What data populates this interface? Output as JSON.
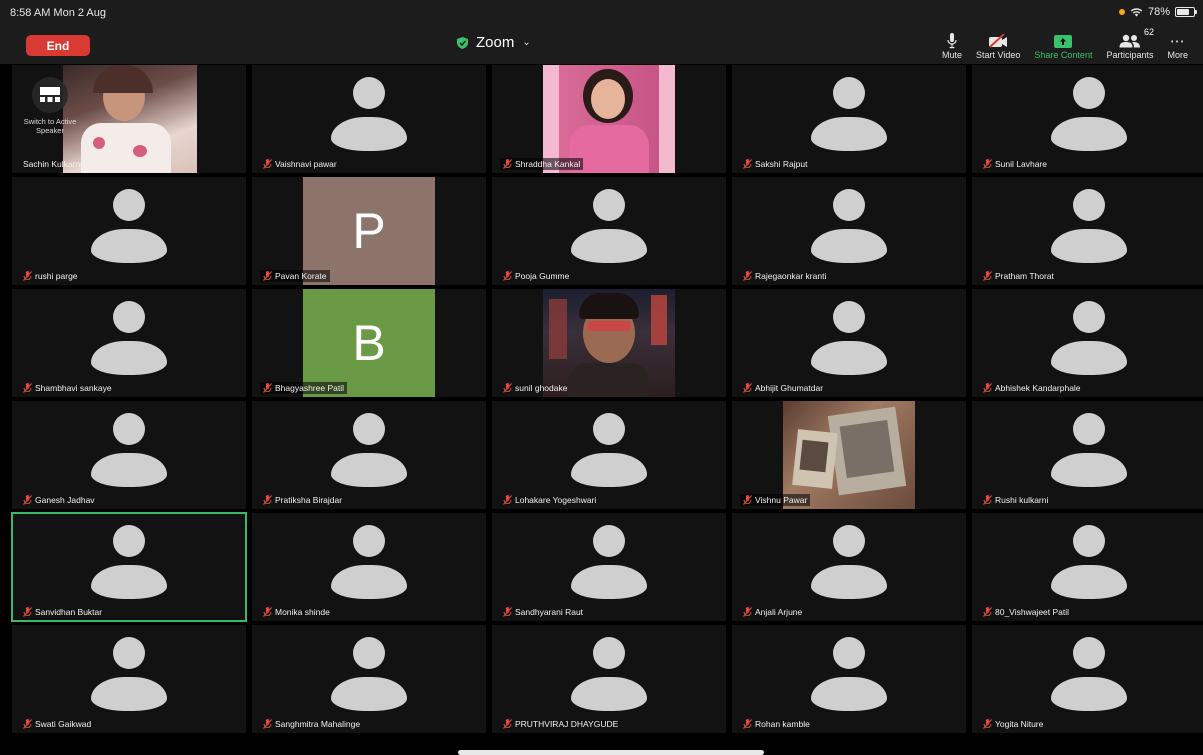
{
  "status": {
    "time": "8:58 AM  Mon 2 Aug",
    "battery": "78%"
  },
  "toolbar": {
    "end_label": "End",
    "title": "Zoom",
    "mute_label": "Mute",
    "video_label": "Start Video",
    "share_label": "Share Content",
    "participants_label": "Participants",
    "participants_count": "62",
    "more_label": "More"
  },
  "switch_speaker_label": "Switch to Active Speaker",
  "colors": {
    "end": "#d93a34",
    "share": "#38c26b",
    "active_border": "#3bb86a",
    "letter_p": "#8c746a",
    "letter_b": "#6a9a46"
  },
  "participants": [
    "Sachin Kulkarni",
    "Vaishnavi pawar",
    "Shraddha Kankal",
    "Sakshi Rajput",
    "Sunil Lavhare",
    "rushi parge",
    "Pavan Korate",
    "Pooja Gumme",
    "Rajegaonkar kranti",
    "Pratham Thorat",
    "Shambhavi sankaye",
    "Bhagyashree Patil",
    "sunil ghodake",
    "Abhijit Ghumatdar",
    "Abhishek Kandarphale",
    "Ganesh Jadhav",
    "Pratiksha Birajdar",
    "Lohakare Yogeshwari",
    "Vishnu Pawar",
    "Rushi kulkarni",
    "Sanvidhan Buktar",
    "Monika shinde",
    "Sandhyarani Raut",
    "Anjali Arjune",
    "80_Vishwajeet Patil",
    "Swati Gaikwad",
    "Sanghmitra Mahalinge",
    "PRUTHVIRAJ DHAYGUDE",
    "Rohan kamble",
    "Yogita Niture"
  ],
  "letters": {
    "pavan": "P",
    "bhagyashree": "B"
  }
}
